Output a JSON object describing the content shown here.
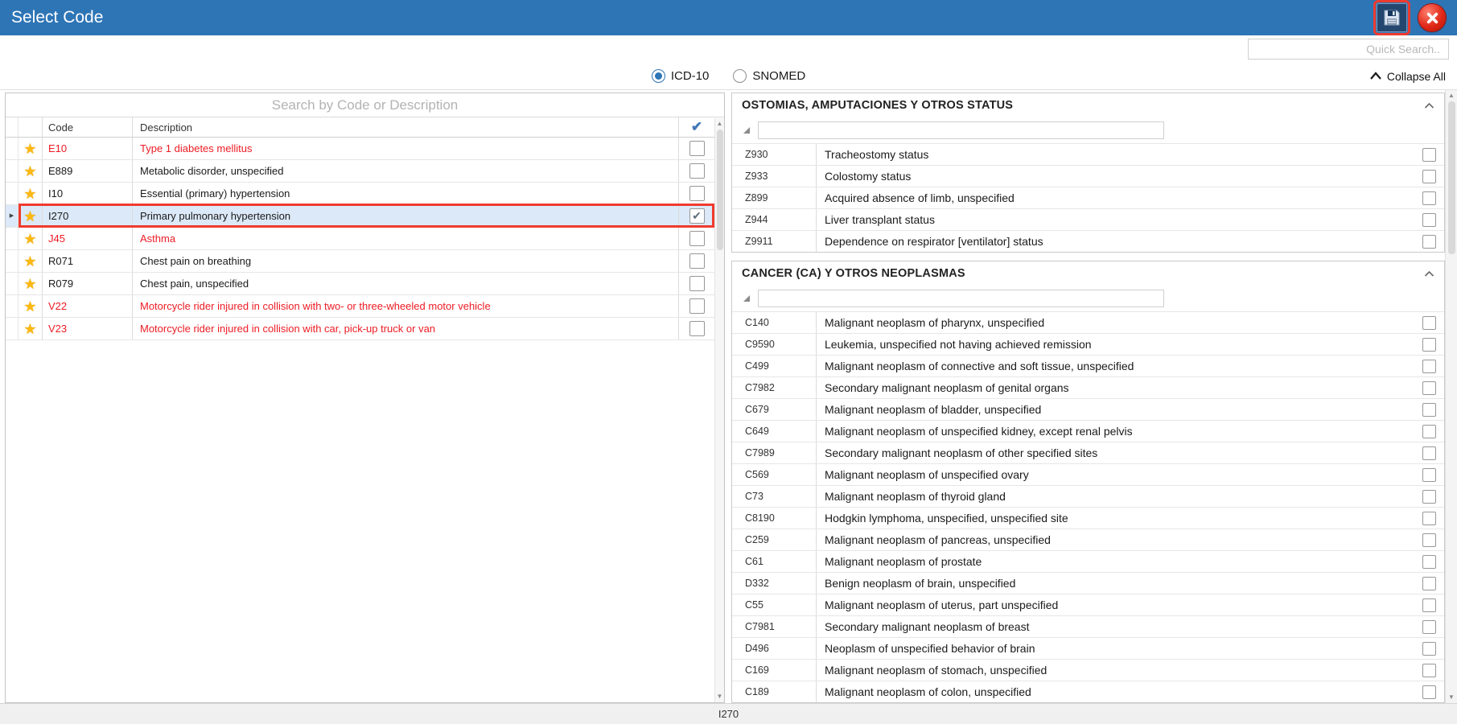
{
  "titlebar": {
    "title": "Select Code",
    "save_icon": "floppy-disk",
    "close_icon": "close-x"
  },
  "quick_search": {
    "placeholder": "Quick Search.."
  },
  "code_system": {
    "options": [
      {
        "label": "ICD-10",
        "selected": true
      },
      {
        "label": "SNOMED",
        "selected": false
      }
    ]
  },
  "collapse_all_label": "Collapse All",
  "left_panel": {
    "search_placeholder": "Search by Code or Description",
    "columns": {
      "code": "Code",
      "description": "Description"
    },
    "rows": [
      {
        "code": "E10",
        "description": "Type 1 diabetes mellitus",
        "favorite": true,
        "red": true,
        "checked": false,
        "selected": false
      },
      {
        "code": "E889",
        "description": "Metabolic disorder, unspecified",
        "favorite": true,
        "red": false,
        "checked": false,
        "selected": false
      },
      {
        "code": "I10",
        "description": "Essential (primary) hypertension",
        "favorite": true,
        "red": false,
        "checked": false,
        "selected": false
      },
      {
        "code": "I270",
        "description": "Primary pulmonary hypertension",
        "favorite": true,
        "red": false,
        "checked": true,
        "selected": true
      },
      {
        "code": "J45",
        "description": "Asthma",
        "favorite": true,
        "red": true,
        "checked": false,
        "selected": false
      },
      {
        "code": "R071",
        "description": "Chest pain on breathing",
        "favorite": true,
        "red": false,
        "checked": false,
        "selected": false
      },
      {
        "code": "R079",
        "description": "Chest pain, unspecified",
        "favorite": true,
        "red": false,
        "checked": false,
        "selected": false
      },
      {
        "code": "V22",
        "description": "Motorcycle rider injured in collision with two- or three-wheeled motor vehicle",
        "favorite": true,
        "red": true,
        "checked": false,
        "selected": false
      },
      {
        "code": "V23",
        "description": "Motorcycle rider injured in collision with car, pick-up truck or van",
        "favorite": true,
        "red": true,
        "checked": false,
        "selected": false
      }
    ]
  },
  "right_panel": {
    "groups": [
      {
        "title": "OSTOMIAS, AMPUTACIONES Y OTROS STATUS",
        "search_value": "",
        "rows": [
          {
            "code": "Z930",
            "description": "Tracheostomy status",
            "checked": false
          },
          {
            "code": "Z933",
            "description": "Colostomy status",
            "checked": false
          },
          {
            "code": "Z899",
            "description": "Acquired absence of limb, unspecified",
            "checked": false
          },
          {
            "code": "Z944",
            "description": "Liver transplant status",
            "checked": false
          },
          {
            "code": "Z9911",
            "description": "Dependence on respirator [ventilator] status",
            "checked": false
          }
        ]
      },
      {
        "title": "CANCER (CA) Y OTROS NEOPLASMAS",
        "search_value": "",
        "rows": [
          {
            "code": "C140",
            "description": "Malignant neoplasm of pharynx, unspecified",
            "checked": false
          },
          {
            "code": "C9590",
            "description": "Leukemia, unspecified not having achieved remission",
            "checked": false
          },
          {
            "code": "C499",
            "description": "Malignant neoplasm of connective and soft tissue, unspecified",
            "checked": false
          },
          {
            "code": "C7982",
            "description": "Secondary malignant neoplasm of genital organs",
            "checked": false
          },
          {
            "code": "C679",
            "description": "Malignant neoplasm of bladder, unspecified",
            "checked": false
          },
          {
            "code": "C649",
            "description": "Malignant neoplasm of unspecified kidney, except renal pelvis",
            "checked": false
          },
          {
            "code": "C7989",
            "description": "Secondary malignant neoplasm of other specified sites",
            "checked": false
          },
          {
            "code": "C569",
            "description": "Malignant neoplasm of unspecified ovary",
            "checked": false
          },
          {
            "code": "C73",
            "description": "Malignant neoplasm of thyroid gland",
            "checked": false
          },
          {
            "code": "C8190",
            "description": "Hodgkin lymphoma, unspecified, unspecified site",
            "checked": false
          },
          {
            "code": "C259",
            "description": "Malignant neoplasm of pancreas, unspecified",
            "checked": false
          },
          {
            "code": "C61",
            "description": "Malignant neoplasm of prostate",
            "checked": false
          },
          {
            "code": "D332",
            "description": "Benign neoplasm of brain, unspecified",
            "checked": false
          },
          {
            "code": "C55",
            "description": "Malignant neoplasm of uterus, part unspecified",
            "checked": false
          },
          {
            "code": "C7981",
            "description": "Secondary malignant neoplasm of breast",
            "checked": false
          },
          {
            "code": "D496",
            "description": "Neoplasm of unspecified behavior of brain",
            "checked": false
          },
          {
            "code": "C169",
            "description": "Malignant neoplasm of stomach, unspecified",
            "checked": false
          },
          {
            "code": "C189",
            "description": "Malignant neoplasm of colon, unspecified",
            "checked": false
          }
        ]
      }
    ]
  },
  "statusbar": {
    "text": "I270"
  },
  "colors": {
    "titlebar_blue": "#2e75b6",
    "alert_red_text": "#ed1c24",
    "selection_background": "#dce9f8",
    "selection_border": "#ee3b2e",
    "favorite_star": "#fdb913",
    "header_check_blue": "#4479b8"
  }
}
